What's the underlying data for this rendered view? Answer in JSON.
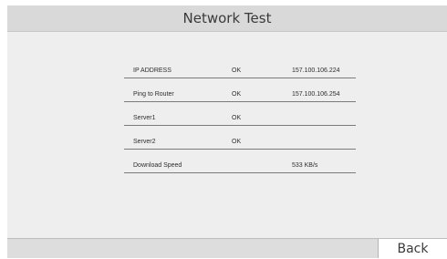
{
  "header": {
    "title": "Network Test"
  },
  "results": [
    {
      "label": "IP ADDRESS",
      "status": "OK",
      "value": "157.100.106.224"
    },
    {
      "label": "Ping to Router",
      "status": "OK",
      "value": "157.100.106.254"
    },
    {
      "label": "Server1",
      "status": "OK",
      "value": ""
    },
    {
      "label": "Server2",
      "status": "OK",
      "value": ""
    },
    {
      "label": "Download Speed",
      "status": "",
      "value": "533 KB/s"
    }
  ],
  "footer": {
    "back_label": "Back"
  }
}
